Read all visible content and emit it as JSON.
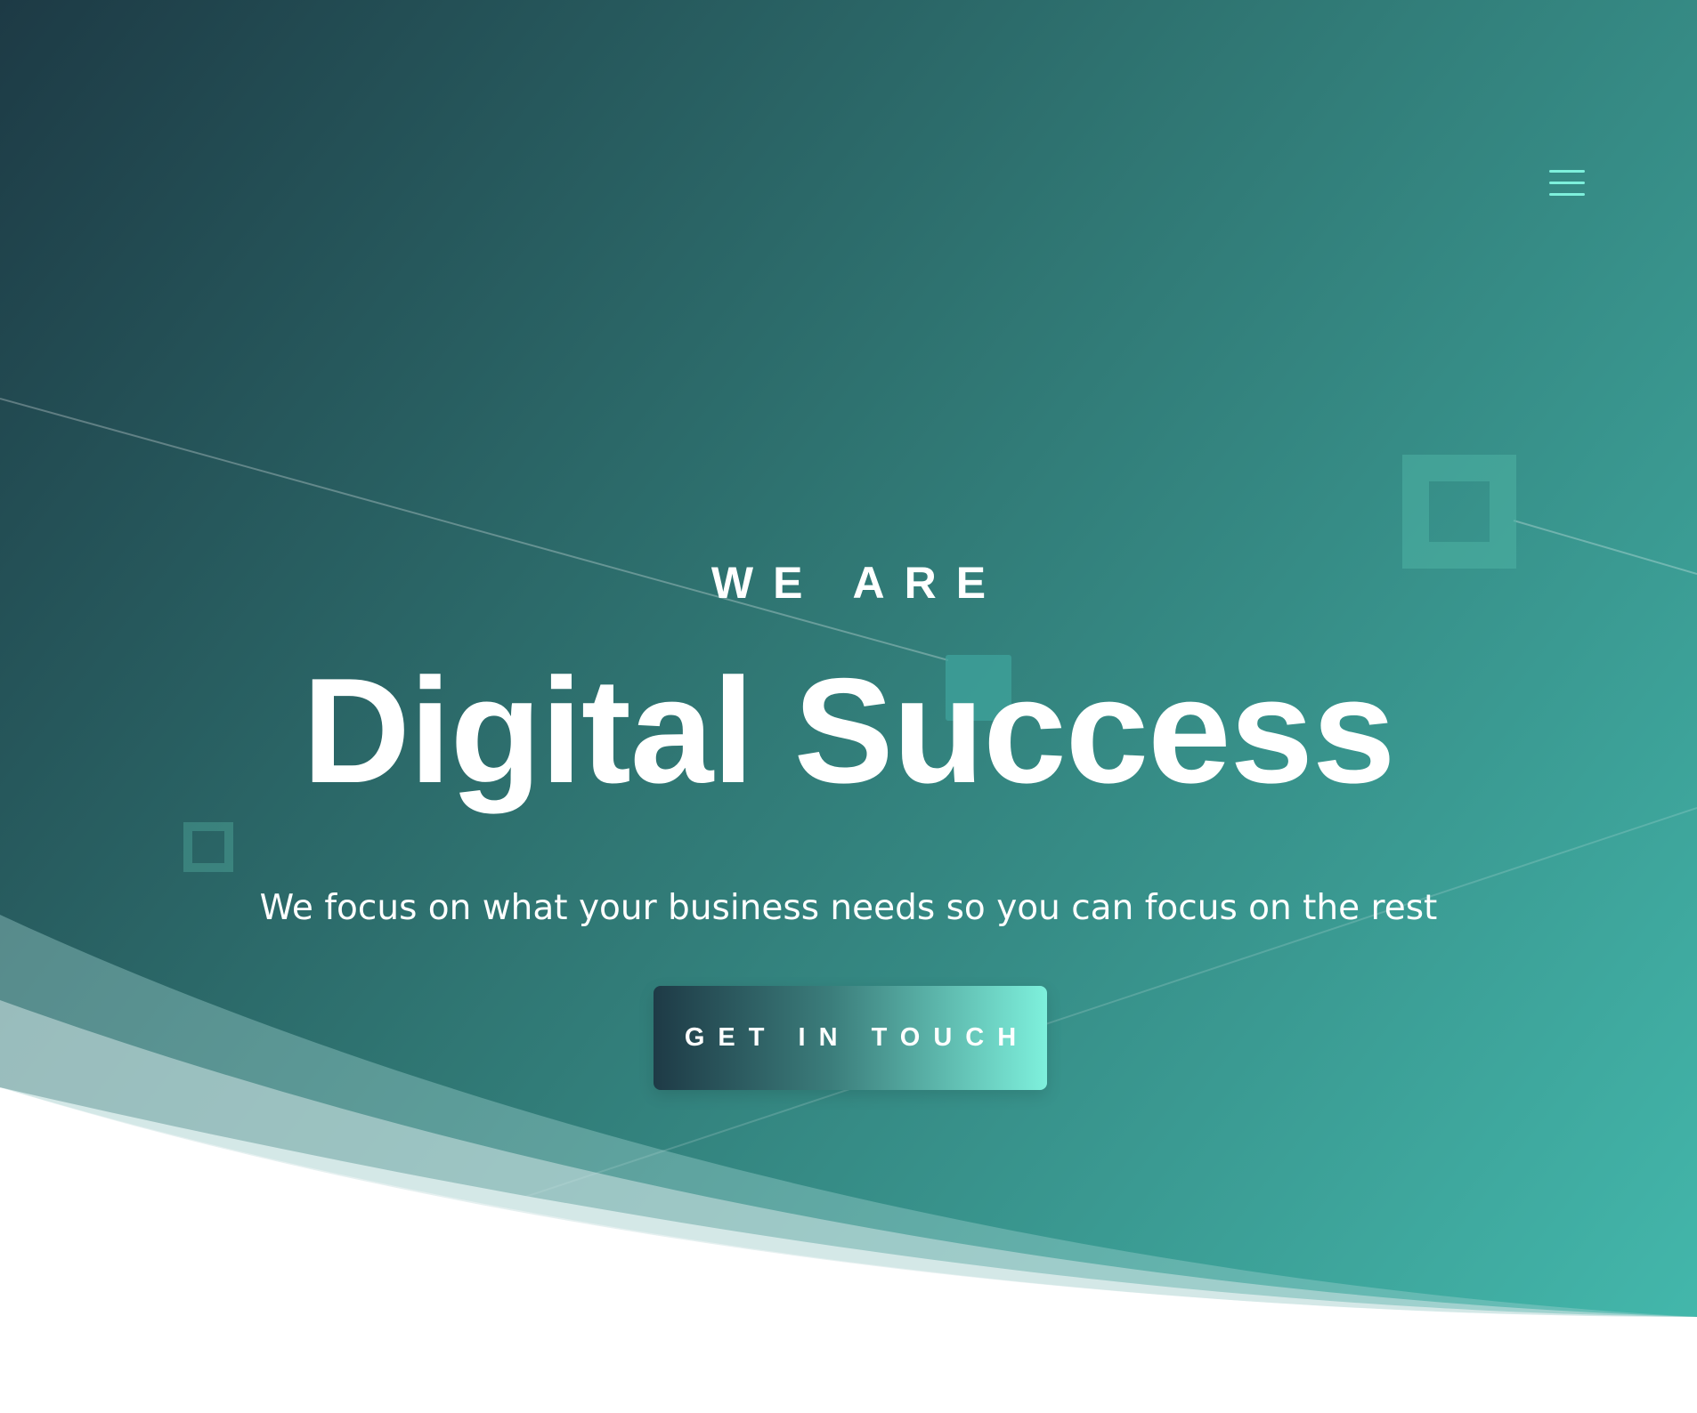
{
  "header": {
    "menu_icon": "hamburger-menu-icon"
  },
  "hero": {
    "eyebrow": "WE ARE",
    "title": "Digital Success",
    "subtitle": "We focus on what your business needs so you can focus on the rest",
    "cta_label": "GET IN TOUCH"
  },
  "colors": {
    "gradient_dark": "#1d3a45",
    "gradient_mid": "#2f7572",
    "gradient_light": "#43b7ab",
    "accent": "#7ef0dc",
    "text": "#ffffff",
    "background": "#ffffff"
  },
  "decorations": {
    "shapes": [
      "square-outline-large",
      "square-outline-small",
      "square-filled",
      "diagonal-lines",
      "wave-bands"
    ]
  }
}
